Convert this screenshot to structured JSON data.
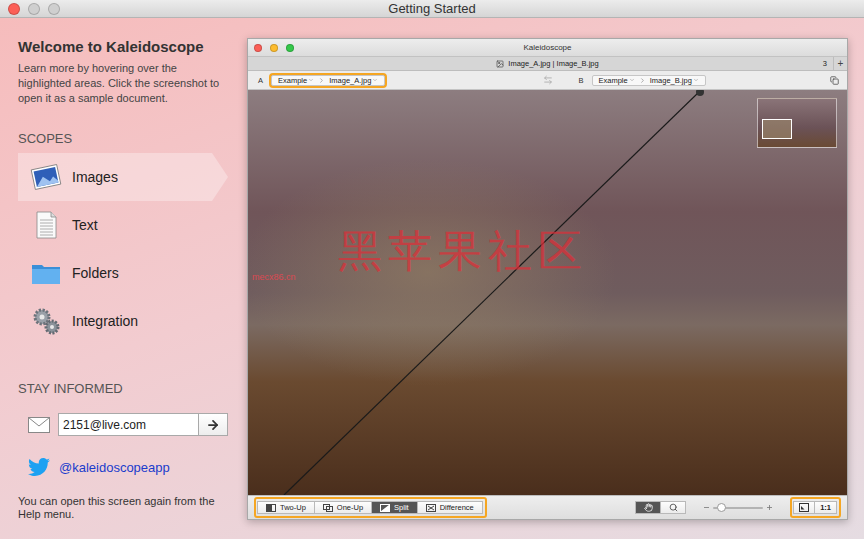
{
  "window": {
    "title": "Getting Started"
  },
  "sidebar": {
    "heading": "Welcome to Kaleidoscope",
    "intro": "Learn more by hovering over the highlighted areas. Click the screenshot to open it as a sample document.",
    "scopes_title": "SCOPES",
    "scopes": [
      {
        "label": "Images",
        "kind": "images",
        "selected": true
      },
      {
        "label": "Text",
        "kind": "text",
        "selected": false
      },
      {
        "label": "Folders",
        "kind": "folders",
        "selected": false
      },
      {
        "label": "Integration",
        "kind": "integration",
        "selected": false
      }
    ],
    "stay_title": "STAY INFORMED",
    "email": {
      "value": "2151@live.com"
    },
    "twitter": "@kaleidoscopeapp",
    "footer": "You can open this screen again from the Help menu."
  },
  "preview": {
    "title": "Kaleidoscope",
    "tab": "Image_A.jpg | Image_B.jpg",
    "tab_count": "3",
    "add_tab": "+",
    "sides": [
      {
        "label": "A",
        "path": [
          "Example",
          "Image_A.jpg"
        ],
        "highlighted": true
      },
      {
        "label": "B",
        "path": [
          "Example",
          "Image_B.jpg"
        ],
        "highlighted": false
      }
    ],
    "modes": [
      {
        "label": "Two-Up",
        "kind": "two-up",
        "selected": false
      },
      {
        "label": "One-Up",
        "kind": "one-up",
        "selected": false
      },
      {
        "label": "Split",
        "kind": "split",
        "selected": true
      },
      {
        "label": "Difference",
        "kind": "difference",
        "selected": false
      }
    ],
    "modes_highlighted": true,
    "tools": [
      {
        "kind": "hand",
        "selected": true
      },
      {
        "kind": "zoom",
        "selected": false
      }
    ],
    "zoom": {
      "level": 0.15
    },
    "actual_size": "1:1",
    "size_controls_highlighted": true,
    "watermark": {
      "text": "黑苹果社区",
      "site": "mecx86.cn"
    }
  }
}
